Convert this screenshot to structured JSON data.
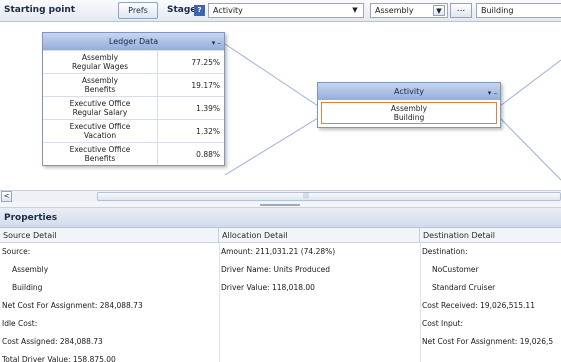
{
  "toolbar": {
    "title": "Starting point",
    "prefs_label": "Prefs",
    "stage_label": "Stage",
    "help_glyph": "?",
    "stage_value": "Activity",
    "first_value": "Assembly",
    "more_label": "...",
    "second_value": "Building"
  },
  "canvas": {
    "ledger": {
      "title": "Ledger Data",
      "controls": "▾ –",
      "rows": [
        {
          "label_line1": "Assembly",
          "label_line2": "Regular Wages",
          "percent": "77.25%"
        },
        {
          "label_line1": "Assembly",
          "label_line2": "Benefits",
          "percent": "19.17%"
        },
        {
          "label_line1": "Executive Office",
          "label_line2": "Regular Salary",
          "percent": "1.39%"
        },
        {
          "label_line1": "Executive Office",
          "label_line2": "Vacation",
          "percent": "1.32%"
        },
        {
          "label_line1": "Executive Office",
          "label_line2": "Benefits",
          "percent": "0.88%"
        }
      ]
    },
    "activity": {
      "title": "Activity",
      "controls": "▾ –",
      "line1": "Assembly",
      "line2": "Building"
    }
  },
  "scrollbar": {
    "left_glyph": "<",
    "grip_glyph": "|||"
  },
  "properties": {
    "title": "Properties",
    "columns": {
      "source": "Source Detail",
      "allocation": "Allocation Detail",
      "destination": "Destination Detail"
    },
    "source_lines": [
      "Source:",
      "Assembly",
      "Building",
      "Net Cost For Assignment: 284,088.73",
      "Idle Cost:",
      "Cost Assigned: 284,088.73",
      "Total Driver Value: 158,875.00"
    ],
    "allocation_lines": [
      "Amount: 211,031.21 (74.28%)",
      "Driver Name: Units Produced",
      "Driver Value: 118,018.00"
    ],
    "destination_lines": [
      "Destination:",
      "NoCustomer",
      "Standard Cruiser",
      "Cost Received: 19,026,515.11",
      "Cost Input:",
      "Net Cost For Assignment: 19,026,5"
    ]
  },
  "colors": {
    "node_header": "#94addb",
    "selected_border": "#e2823a",
    "link_line": "#9bb0d3"
  }
}
